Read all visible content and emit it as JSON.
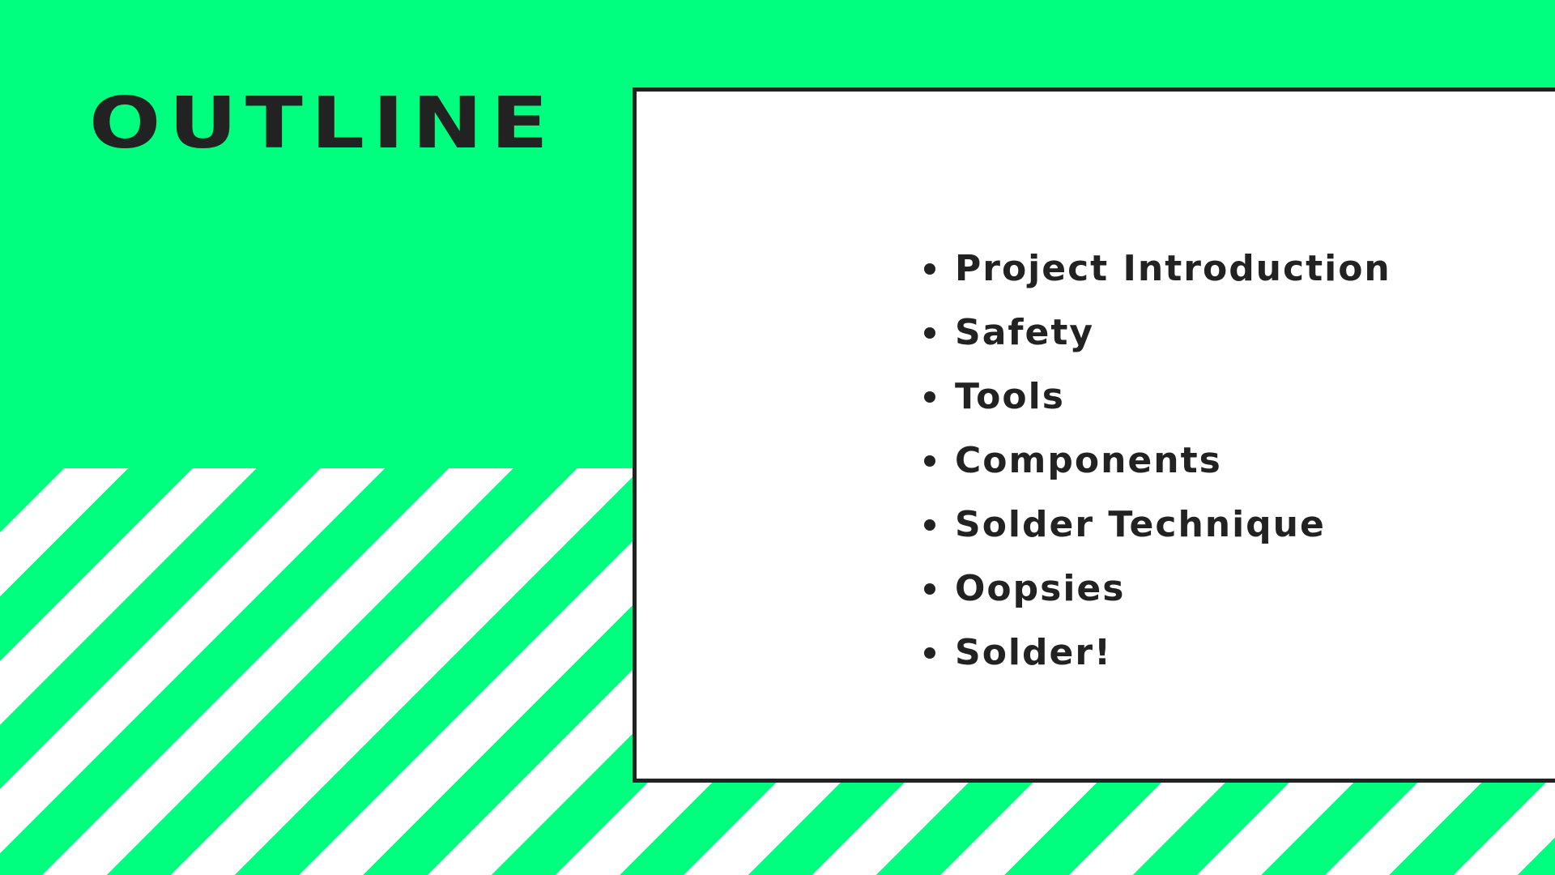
{
  "slide": {
    "title": "OUTLINE",
    "items": [
      "Project Introduction",
      "Safety",
      "Tools",
      "Components",
      "Solder Technique",
      "Oopsies",
      "Solder!"
    ]
  },
  "colors": {
    "accent_green": "#00ff7f",
    "text_dark": "#222222",
    "card_background": "#ffffff"
  }
}
